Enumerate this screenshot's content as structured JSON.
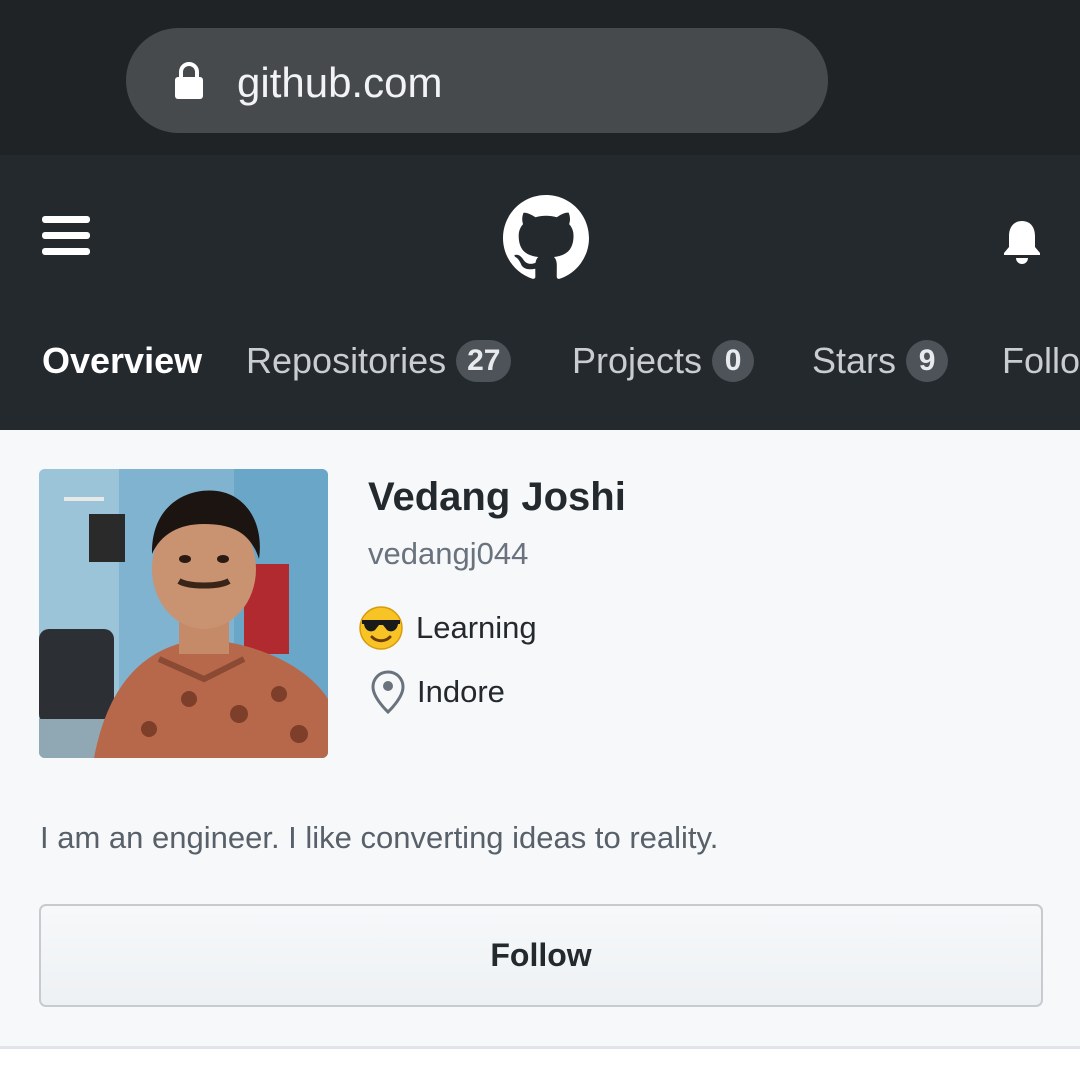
{
  "browser": {
    "url": "github.com",
    "icons": {
      "lock": "lock-icon"
    },
    "colors": {
      "bar": "#202326",
      "pill": "#474a4d"
    }
  },
  "header": {
    "icons": {
      "menu": "hamburger-menu-icon",
      "logo": "github-octocat-logo",
      "notifications": "bell-icon"
    },
    "colors": {
      "background": "#24292e"
    }
  },
  "tabs": [
    {
      "label": "Overview",
      "active": true
    },
    {
      "label": "Repositories",
      "count": "27"
    },
    {
      "label": "Projects",
      "count": "0"
    },
    {
      "label": "Stars",
      "count": "9"
    },
    {
      "label": "Follo"
    }
  ],
  "profile": {
    "name": "Vedang Joshi",
    "username": "vedangj044",
    "status": {
      "emoji": "smiling-face-with-sunglasses",
      "text": "Learning"
    },
    "location": {
      "icon": "location-pin-icon",
      "text": "Indore"
    },
    "bio": "I am an engineer. I like converting ideas to reality.",
    "follow_label": "Follow"
  }
}
